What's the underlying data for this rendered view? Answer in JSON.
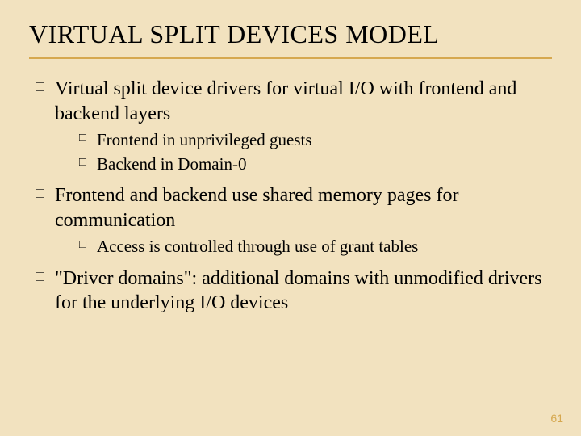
{
  "title": "VIRTUAL SPLIT DEVICES MODEL",
  "bullets": [
    {
      "text": "Virtual split device drivers for virtual I/O with frontend and backend layers",
      "sub": [
        {
          "text": "Frontend in unprivileged guests"
        },
        {
          "text": "Backend in Domain-0"
        }
      ]
    },
    {
      "text": "Frontend and backend use shared memory pages for communication",
      "sub": [
        {
          "text": "Access is controlled through use of grant tables"
        }
      ]
    },
    {
      "text": "\"Driver domains\": additional domains with unmodified drivers for the underlying I/O devices",
      "sub": []
    }
  ],
  "page_number": "61"
}
